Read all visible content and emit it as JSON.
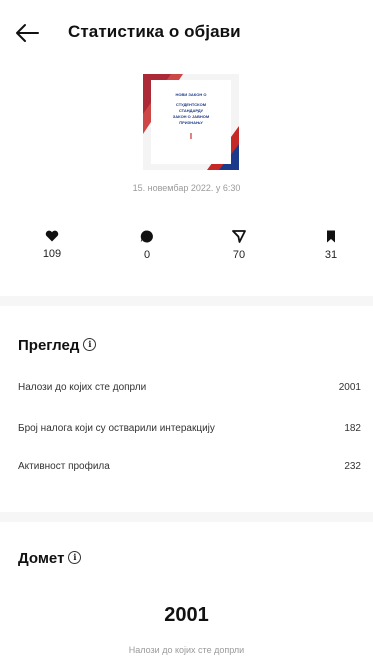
{
  "header": {
    "title": "Статистика о објави"
  },
  "post": {
    "image_text": [
      "НОВИ ЗАКОН О",
      "СТУДЕНТСКОМ",
      "СТАНДАРДУ",
      "ЗАКОН О ЈАВНОМ",
      "ПРИЗНАЊУ",
      "I"
    ],
    "date": "15. новембар 2022. у 6:30"
  },
  "stats": {
    "likes": {
      "icon": "heart-icon",
      "value": "109"
    },
    "comments": {
      "icon": "comment-icon",
      "value": "0"
    },
    "shares": {
      "icon": "send-icon",
      "value": "70"
    },
    "saves": {
      "icon": "bookmark-icon",
      "value": "31"
    }
  },
  "overview": {
    "title": "Преглед",
    "rows": [
      {
        "label": "Налози до којих сте допрли",
        "value": "2001"
      },
      {
        "label": "Број налога који су остварили интеракцију",
        "value": "182"
      },
      {
        "label": "Активност профила",
        "value": "232"
      }
    ]
  },
  "reach": {
    "title": "Домет",
    "value": "2001",
    "caption": "Налози до којих сте допрли"
  },
  "colors": {
    "accent_red": "#c62828",
    "accent_blue": "#1c3a8a",
    "divider": "#f6f6f6"
  }
}
